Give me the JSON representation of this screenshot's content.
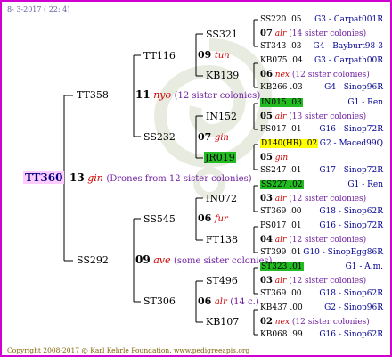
{
  "header": {
    "date": "8-  3-2017 ( 22: 4)"
  },
  "root": {
    "name": "TT360",
    "num": "13",
    "code": "gin",
    "note": "(Drones from 12 sister colonies)"
  },
  "gen1": [
    {
      "name": "TT358",
      "num": "11",
      "code": "nyo",
      "note": "(12 sister colonies)"
    },
    {
      "name": "SS292",
      "num": "09",
      "code": "ave",
      "note": "(some sister colonies)"
    }
  ],
  "gen2": [
    {
      "name": "TT116",
      "num": "09",
      "code": "tun"
    },
    {
      "name": "SS232",
      "num": "07",
      "code": "gin"
    },
    {
      "name": "SS545",
      "num": "06",
      "code": "fur"
    },
    {
      "name": "ST306",
      "num": "06",
      "code": "alr",
      "note": "(14 c.)"
    }
  ],
  "gen3": [
    {
      "name": "SS321"
    },
    {
      "name": "KB139"
    },
    {
      "name": "IN152"
    },
    {
      "name": "JR019"
    },
    {
      "name": "IN072"
    },
    {
      "name": "FT138"
    },
    {
      "name": "ST496"
    },
    {
      "name": "KB107"
    }
  ],
  "gen4": [
    {
      "a": "SS220 .05",
      "ab": "G3 - Carpat001R",
      "num": "07",
      "code": "alr",
      "note": "(14 sister colonies)",
      "b": "ST343 .03",
      "bb": "G4 - Bayburt98-3"
    },
    {
      "a": "KB075 .04",
      "ab": "G3 - Carpath00R",
      "num": "06",
      "code": "nex",
      "note": "(12 sister colonies)",
      "b": "KB266 .03",
      "bb": "G4 - Sinop96R"
    },
    {
      "a": "IN015 .03",
      "ab": "G1 - Ren",
      "num": "05",
      "code": "alr",
      "note": "(13 sister colonies)",
      "b": "PS017 .01",
      "bb": "G16 - Sinop72R"
    },
    {
      "a": "D140(HR) .02",
      "ab": "G2 - Maced99Q",
      "num": "05",
      "code": "gin",
      "note": "",
      "b": "SS247 .01",
      "bb": "G17 - Sinop72R"
    },
    {
      "a": "SS227 .02",
      "ab": "G1 - Ren",
      "num": "03",
      "code": "alr",
      "note": "(12 sister colonies)",
      "b": "ST369 .00",
      "bb": "G18 - Sinop62R"
    },
    {
      "a": "PS017 .01",
      "ab": "G16 - Sinop72R",
      "num": "04",
      "code": "alr",
      "note": "(12 sister colonies)",
      "b": "ST399 .01",
      "bb": "G10 - SinopEgg86R"
    },
    {
      "a": "ST323 .01",
      "ab": "G1 - A.m.",
      "num": "03",
      "code": "alr",
      "note": "(12 sister colonies)",
      "b": "ST369 .00",
      "bb": "G18 - Sinop62R"
    },
    {
      "a": "KB437 .00",
      "ab": "G2 - Sinop96R",
      "num": "02",
      "code": "nex",
      "note": "(12 sister colonies)",
      "b": "KB068 .99",
      "bb": "G16 - Sinop62R"
    }
  ],
  "footer": "Copyright 2008-2017 @ Karl Kehrle Foundation.   www.pedigreeapis.org",
  "colors": {
    "frame": "#d000d0",
    "root_bg": "#ffccff",
    "highlight_green": "#22bb22",
    "highlight_yellow": "#ffff00",
    "code_red": "#d00000",
    "label_blue": "#000090"
  }
}
